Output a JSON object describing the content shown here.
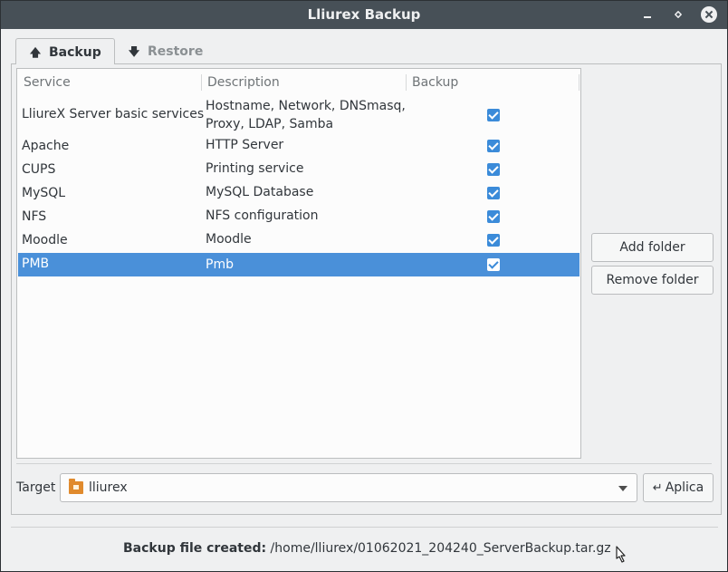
{
  "window": {
    "title": "Lliurex Backup"
  },
  "tabs": [
    {
      "label": "Backup",
      "icon": "up-arrow-icon",
      "active": true
    },
    {
      "label": "Restore",
      "icon": "down-arrow-icon",
      "active": false
    }
  ],
  "table": {
    "columns": [
      "Service",
      "Description",
      "Backup"
    ],
    "rows": [
      {
        "service": "LliureX Server basic services",
        "description_line1": "Hostname, Network, DNSmasq,",
        "description_line2": "Proxy, LDAP, Samba",
        "backup": true,
        "selected": false
      },
      {
        "service": "Apache",
        "description": "HTTP Server",
        "backup": true,
        "selected": false
      },
      {
        "service": "CUPS",
        "description": "Printing service",
        "backup": true,
        "selected": false
      },
      {
        "service": "MySQL",
        "description": "MySQL Database",
        "backup": true,
        "selected": false
      },
      {
        "service": "NFS",
        "description": "NFS configuration",
        "backup": true,
        "selected": false
      },
      {
        "service": "Moodle",
        "description": "Moodle",
        "backup": true,
        "selected": false
      },
      {
        "service": "PMB",
        "description": "Pmb",
        "backup": true,
        "selected": true
      }
    ]
  },
  "side_buttons": {
    "add_folder": "Add folder",
    "remove_folder": "Remove folder"
  },
  "target": {
    "label": "Target",
    "value": "lliurex",
    "icon": "home-folder-icon"
  },
  "apply_button": {
    "label": "Aplica",
    "icon": "return-arrow-icon"
  },
  "status": {
    "prefix": "Backup file created:",
    "path": "/home/lliurex/01062021_204240_ServerBackup.tar.gz"
  },
  "colors": {
    "titlebar": "#475057",
    "selection": "#4a90d9",
    "checkbox": "#3b8bd9",
    "window_bg": "#eff0f1"
  }
}
